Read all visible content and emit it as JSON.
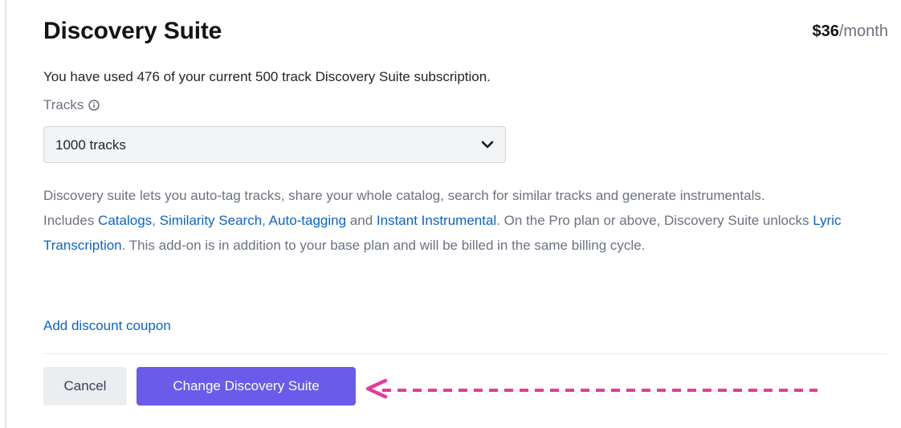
{
  "header": {
    "title": "Discovery Suite",
    "price_amount": "$36",
    "price_period": "/month"
  },
  "usage": {
    "text": "You have used 476 of your current 500 track Discovery Suite subscription."
  },
  "tracks": {
    "label": "Tracks",
    "selected": "1000 tracks"
  },
  "description": {
    "line1": "Discovery suite lets you auto-tag tracks, share your whole catalog, search for similar tracks and generate instrumentals.",
    "includes_prefix": "Includes ",
    "link_catalogs": "Catalogs",
    "sep1": ", ",
    "link_similarity": "Similarity Search",
    "sep2": ", ",
    "link_autotagging": "Auto-tagging",
    "sep3": " and ",
    "link_instrumental": "Instant Instrumental",
    "middle": ". On the Pro plan or above, Discovery Suite unlocks ",
    "link_lyric": "Lyric Transcription",
    "suffix": ". This add-on is in addition to your base plan and will be billed in the same billing cycle."
  },
  "coupon": {
    "label": "Add discount coupon"
  },
  "actions": {
    "cancel_label": "Cancel",
    "change_label": "Change Discovery Suite"
  },
  "icons": {
    "info": "info-circle-icon",
    "chevron": "chevron-down-icon",
    "annotation": "dashed-arrow-left-icon"
  },
  "colors": {
    "primary_button": "#6b5bea",
    "link": "#0b64c8",
    "annotation_arrow": "#e8399a"
  }
}
